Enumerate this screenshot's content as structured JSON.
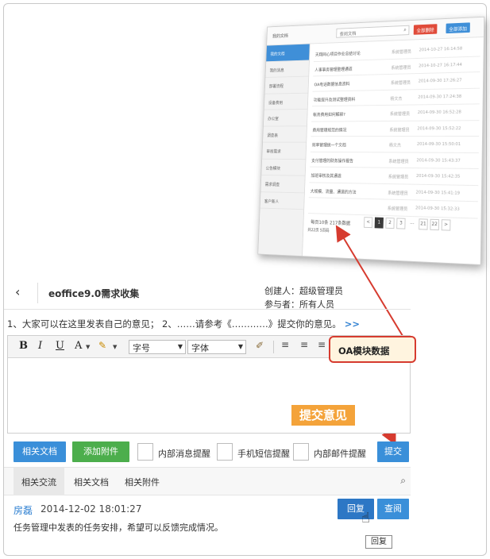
{
  "thumbnail": {
    "title": "我的文档",
    "search_placeholder": "查阅文档",
    "btn_red": "全部删除",
    "btn_blue": "全部添加",
    "sidebar": [
      "我的文档",
      "我的消息",
      "部署流程",
      "设备费用",
      "办公室",
      "调查表",
      "审核需求",
      "公告模块",
      "需求调查",
      "客户新人"
    ],
    "rows": [
      {
        "title": "天翔同心项目作业总结讨论",
        "author": "系统管理员",
        "date": "2014-10-27 16:14:58"
      },
      {
        "title": "人事事务管理整理通道",
        "author": "系统管理员",
        "date": "2014-10-27 16:17:44"
      },
      {
        "title": "OA电话数据信息资料",
        "author": "系统管理员",
        "date": "2014-09-30 17:26:27"
      },
      {
        "title": "功能提升及测试整理资料",
        "author": "杨文杰",
        "date": "2014-09-30 17:24:38"
      },
      {
        "title": "帐务费用如何解释?",
        "author": "系统管理员",
        "date": "2014-09-30 16:52:28"
      },
      {
        "title": "费用管理规范的情况",
        "author": "系统管理员",
        "date": "2014-09-30 15:52:22"
      },
      {
        "title": "效率管理统一个文档",
        "author": "杨文杰",
        "date": "2014-09-30 15:50:01"
      },
      {
        "title": "支付管理的财务操作报告",
        "author": "系统管理员",
        "date": "2014-09-30 15:43:37"
      },
      {
        "title": "加班审核及其通道",
        "author": "系统管理员",
        "date": "2014-09-30 15:42:35"
      },
      {
        "title": "大规模、流量、通道的方法",
        "author": "系统管理员",
        "date": "2014-09-30 15:41:19"
      },
      {
        "title": "",
        "author": "系统管理员",
        "date": "2014-09-30 15:32:33"
      }
    ],
    "footer_text": "每页10条 217条数据",
    "footer_text2": "共22页 5页码",
    "pager": [
      "<",
      "1",
      "2",
      "3",
      "...",
      "21",
      "22",
      ">"
    ]
  },
  "header": {
    "back_icon": "‹",
    "title": "eoffice9.0需求收集",
    "creator": "创建人：超级管理员",
    "participants": "参与者：所有人员"
  },
  "description": {
    "text": "1、大家可以在这里发表自己的意见； 2、……请参考《…………》提交你的意见。",
    "more": ">>"
  },
  "toolbar": {
    "bold": "B",
    "italic": "I",
    "underline": "U",
    "font_color": "A",
    "font_size": "字号",
    "font_family": "字体",
    "oa_module": "OA模块数据"
  },
  "callout": "提交意见",
  "actions": {
    "related_docs": "相关文档",
    "add_attachment": "添加附件",
    "internal_msg": "内部消息提醒",
    "sms": "手机短信提醒",
    "internal_mail": "内部邮件提醒",
    "submit": "提交"
  },
  "tabs": [
    "相关交流",
    "相关文档",
    "相关附件"
  ],
  "comment": {
    "name": "房磊",
    "time": "2014-12-02 18:01:27",
    "reply": "回复",
    "view": "查阅",
    "body": "任务管理中发表的任务安排，希望可以反馈完成情况。",
    "tooltip": "回复"
  },
  "colors": {
    "accent_blue": "#3a8fd9",
    "green": "#4cae4c",
    "orange": "#f4a33a",
    "red": "#d63b2f"
  }
}
